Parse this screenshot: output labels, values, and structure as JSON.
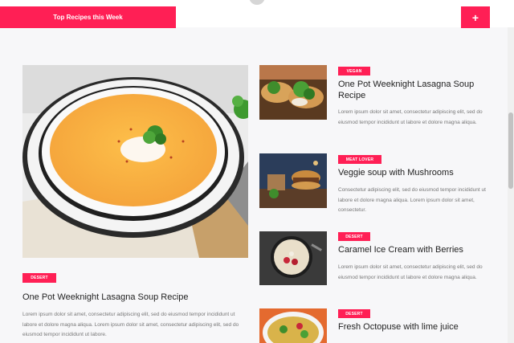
{
  "header": {
    "tab_label": "Top Recipes this Week",
    "plus_label": "+"
  },
  "featured": {
    "badge": "DESERT",
    "title": "One Pot Weeknight Lasagna Soup Recipe",
    "excerpt": "Lorem ipsum dolor sit amet, consectetur adipiscing elit, sed do eiusmod tempor incididunt ut labore et dolore magna aliqua. Lorem ipsum dolor sit amet, consectetur adipiscing elit, sed do eiusmod tempor incididunt ut labore."
  },
  "recipes": [
    {
      "badge": "VEGAN",
      "title": "One Pot Weeknight Lasagna Soup Recipe",
      "excerpt": "Lorem ipsum dolor sit amet, consectetur adipiscing elit, sed do eiusmod tempor incididunt ut labore et dolore magna aliqua."
    },
    {
      "badge": "MEAT LOVER",
      "title": "Veggie soup with Mushrooms",
      "excerpt": "Consectetur adipiscing elit, sed do eiusmod tempor incididunt ut labore et dolore magna aliqua. Lorem ipsum dolor sit amet, consectetur."
    },
    {
      "badge": "DESERT",
      "title": "Caramel Ice Cream with Berries",
      "excerpt": "Lorem ipsum dolor sit amet, consectetur adipiscing elit, sed do eiusmod tempor incididunt ut labore et dolore magna aliqua."
    },
    {
      "badge": "DESERT",
      "title": "Fresh Octopuse with lime juice",
      "excerpt": ""
    }
  ],
  "colors": {
    "accent": "#ff1f55"
  }
}
